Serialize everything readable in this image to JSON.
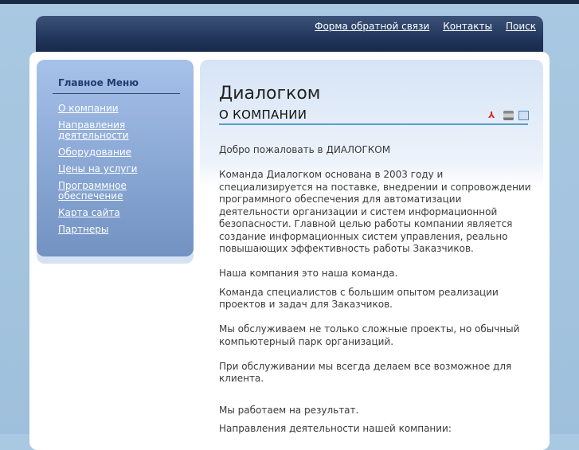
{
  "header": {
    "links": [
      "Форма обратной связи",
      "Контакты",
      "Поиск"
    ]
  },
  "sidebar": {
    "title": "Главное Меню",
    "items": [
      "О компании",
      "Направления деятельности",
      "Оборудование",
      "Цены на услуги",
      "Программное обеспечение",
      "Карта сайта",
      "Партнеры"
    ]
  },
  "main": {
    "title": "Диалогком",
    "subtitle": "О КОМПАНИИ",
    "icons": [
      "pdf-icon",
      "print-icon",
      "email-icon"
    ],
    "paragraphs": [
      "Добро пожаловать в ДИАЛОГКОМ",
      "Команда Диалогком основана  в 2003 году и специализируется на поставке, внедрении и сопровождении программного обеспечения для автоматизации деятельности организации и систем информационной безопасности. Главной целью работы компании является создание информационных систем управления, реально повышающих эффективность работы Заказчиков.",
      "Наша компания это наша команда.",
      "Команда специалистов с большим опытом реализации проектов и задач для Заказчиков.",
      "Мы обслуживаем не только сложные проекты, но обычный компьютерный парк организаций.",
      "При обслуживании мы всегда делаем все возможное для клиента.",
      "Мы работаем на результат.",
      "Направления деятельности нашей компании:"
    ]
  }
}
